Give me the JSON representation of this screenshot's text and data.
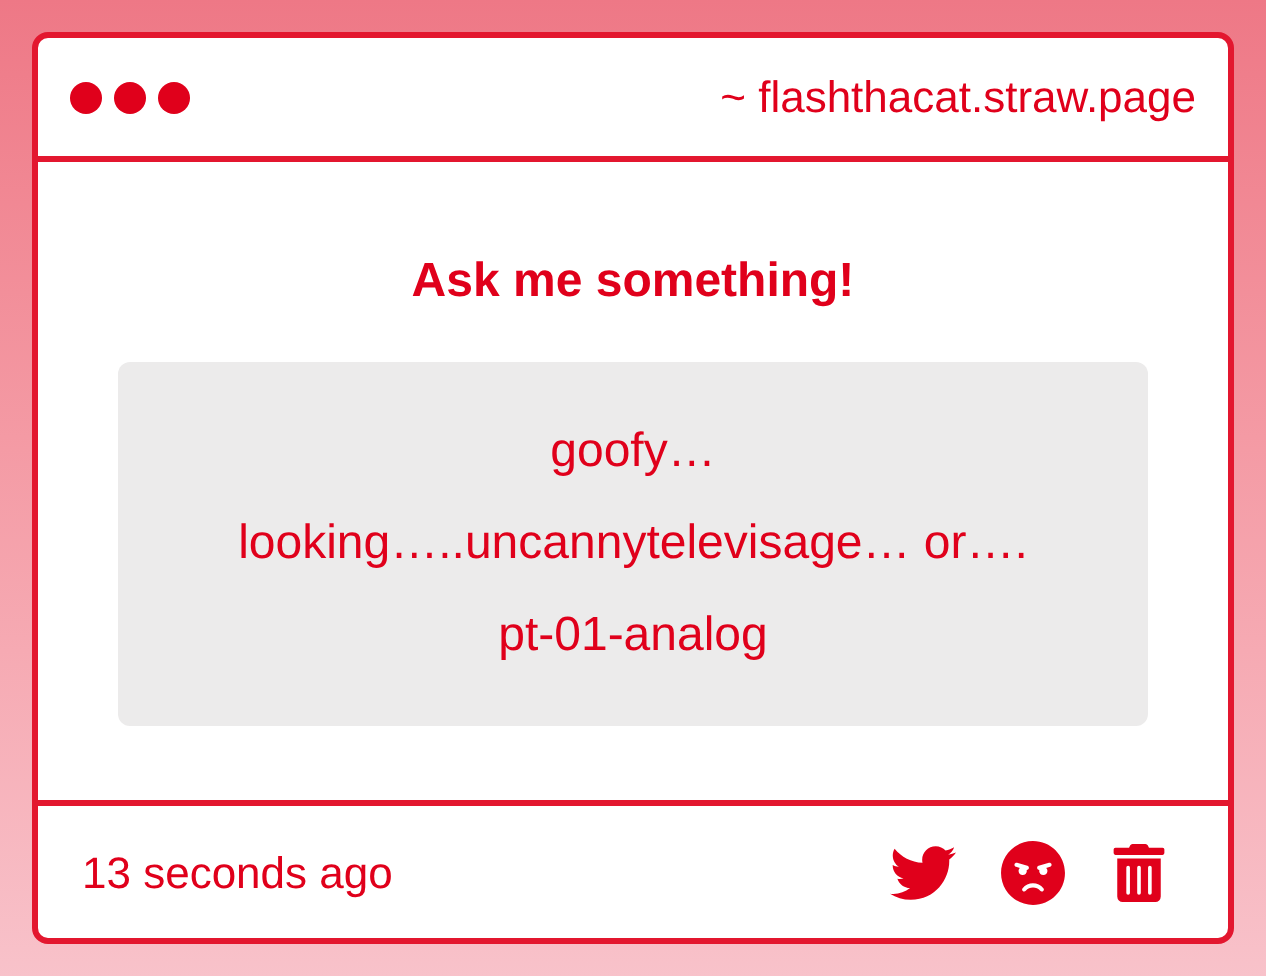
{
  "window": {
    "title": "~ flashthacat.straw.page"
  },
  "question": {
    "heading": "Ask me something!",
    "lines": [
      "goofy…",
      "looking…..uncannytelevisage… or….",
      "pt-01-analog"
    ]
  },
  "footer": {
    "time": "13 seconds ago"
  }
}
